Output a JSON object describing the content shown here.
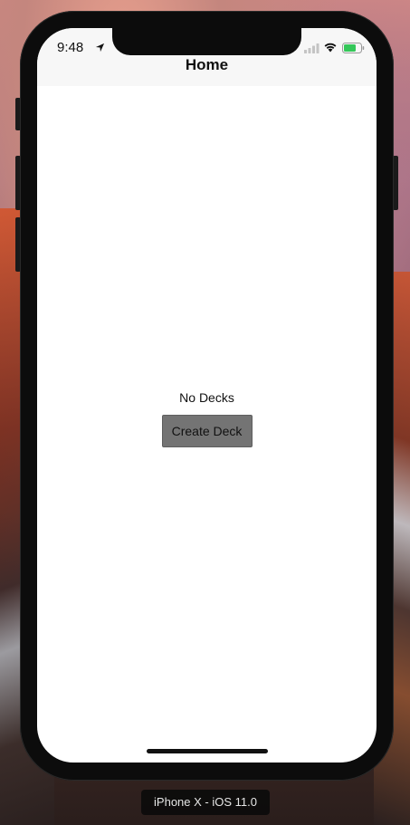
{
  "status_bar": {
    "time": "9:48",
    "location_icon": "location-arrow-icon",
    "signal_icon": "cellular-signal-icon",
    "wifi_icon": "wifi-icon",
    "battery_icon": "battery-icon",
    "battery_color": "#34c759"
  },
  "nav_bar": {
    "title": "Home"
  },
  "main": {
    "empty_text": "No Decks",
    "create_button_label": "Create Deck",
    "button_color": "#747474"
  },
  "simulator": {
    "device_label": "iPhone X - iOS 11.0"
  }
}
